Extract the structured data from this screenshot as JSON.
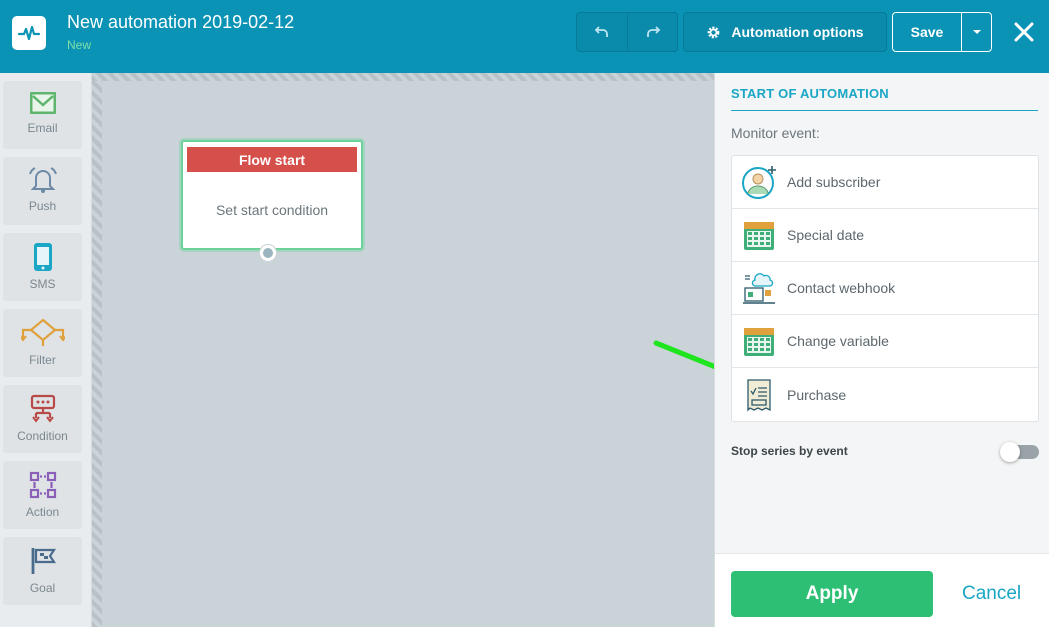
{
  "header": {
    "title": "New automation 2019-02-12",
    "status": "New",
    "options_label": "Automation options",
    "save_label": "Save"
  },
  "sidebar": {
    "tools": [
      {
        "label": "Email",
        "icon": "email-icon"
      },
      {
        "label": "Push",
        "icon": "bell-icon"
      },
      {
        "label": "SMS",
        "icon": "phone-icon"
      },
      {
        "label": "Filter",
        "icon": "filter-icon"
      },
      {
        "label": "Condition",
        "icon": "condition-icon"
      },
      {
        "label": "Action",
        "icon": "action-icon"
      },
      {
        "label": "Goal",
        "icon": "flag-icon"
      }
    ]
  },
  "canvas": {
    "node": {
      "title": "Flow start",
      "body": "Set start condition"
    }
  },
  "panel": {
    "heading": "START OF AUTOMATION",
    "monitor_label": "Monitor event:",
    "events": [
      {
        "label": "Add subscriber",
        "icon": "add-subscriber-icon"
      },
      {
        "label": "Special date",
        "icon": "calendar-icon"
      },
      {
        "label": "Contact webhook",
        "icon": "webhook-icon"
      },
      {
        "label": "Change variable",
        "icon": "calendar-icon"
      },
      {
        "label": "Purchase",
        "icon": "receipt-icon"
      }
    ],
    "stop_series_label": "Stop series by event",
    "apply_label": "Apply",
    "cancel_label": "Cancel"
  },
  "colors": {
    "header": "#0a93b5",
    "accent": "#1aa6c5",
    "apply": "#2dbf73",
    "node_head": "#d6504b",
    "arrow": "#1ee51e"
  }
}
